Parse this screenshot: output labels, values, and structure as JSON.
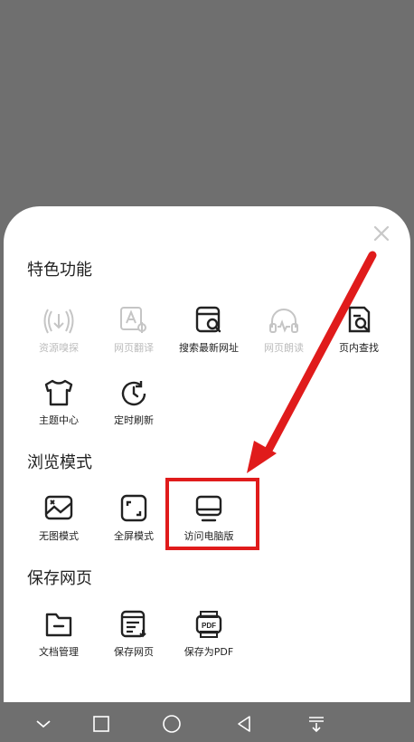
{
  "sections": {
    "features": {
      "title": "特色功能",
      "items": [
        {
          "label": "资源嗅探",
          "icon": "wireless-signal-icon",
          "enabled": false
        },
        {
          "label": "网页翻译",
          "icon": "translate-icon",
          "enabled": false
        },
        {
          "label": "搜索最新网址",
          "icon": "search-page-icon",
          "enabled": true
        },
        {
          "label": "网页朗读",
          "icon": "headphones-icon",
          "enabled": false
        },
        {
          "label": "页内查找",
          "icon": "find-in-page-icon",
          "enabled": true
        },
        {
          "label": "主题中心",
          "icon": "tshirt-icon",
          "enabled": true
        },
        {
          "label": "定时刷新",
          "icon": "timer-refresh-icon",
          "enabled": true
        }
      ]
    },
    "browse_mode": {
      "title": "浏览模式",
      "items": [
        {
          "label": "无图模式",
          "icon": "no-image-icon",
          "enabled": true
        },
        {
          "label": "全屏模式",
          "icon": "fullscreen-icon",
          "enabled": true
        },
        {
          "label": "访问电脑版",
          "icon": "desktop-monitor-icon",
          "enabled": true
        }
      ]
    },
    "save_page": {
      "title": "保存网页",
      "items": [
        {
          "label": "文档管理",
          "icon": "folder-icon",
          "enabled": true
        },
        {
          "label": "保存网页",
          "icon": "save-page-icon",
          "enabled": true
        },
        {
          "label": "保存为PDF",
          "icon": "pdf-icon",
          "enabled": true
        }
      ]
    }
  },
  "nav": {
    "icons": [
      "chevron-down-icon",
      "square-icon",
      "circle-icon",
      "back-triangle-icon",
      "menu-down-icon"
    ]
  },
  "colors": {
    "accent_annotation": "#e01b1b",
    "icon": "#222222",
    "disabled": "#bcbcbc"
  }
}
